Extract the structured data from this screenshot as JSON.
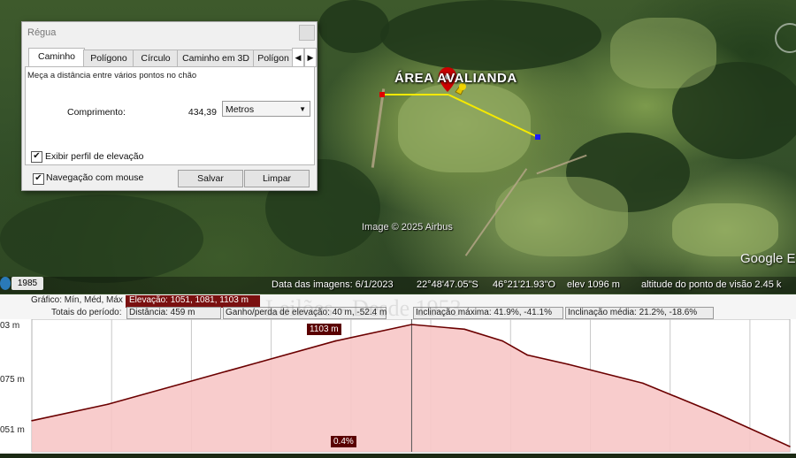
{
  "map": {
    "area_label": "ÁREA AVALIANDA",
    "image_credit": "Image © 2025 Airbus",
    "google_logo": "Google E",
    "status": {
      "year": "1985",
      "imagery_date": "Data das imagens: 6/1/2023",
      "latitude": "22°48'47.05\"S",
      "longitude": "46°21'21.93\"O",
      "elevation": "elev 1096 m",
      "eye_altitude": "altitude do ponto de visão 2.45 k"
    },
    "path_color": "#f5e900",
    "start_marker_color": "#e00000",
    "end_marker_color": "#1a1aff",
    "pin_color": "#e4c400"
  },
  "dialog": {
    "title": "Régua",
    "tabs": [
      "Caminho",
      "Polígono",
      "Círculo",
      "Caminho em 3D",
      "Polígon"
    ],
    "active_tab": "Caminho",
    "tab_prev": "◀",
    "tab_next": "▶",
    "description": "Meça a distância entre vários pontos no chão",
    "length_label": "Comprimento:",
    "length_value": "434,39",
    "unit": "Metros",
    "show_elevation_label": "Exibir perfil de elevação",
    "show_elevation_checked": true,
    "mouse_nav_label": "Navegação com mouse",
    "mouse_nav_checked": true,
    "save_label": "Salvar",
    "clear_label": "Limpar",
    "check_mark": "✔"
  },
  "elevation_panel": {
    "row1": {
      "prefix": "Gráfico: Mín, Méd, Máx",
      "elevation": "Elevação: 1051, 1081, 1103 m"
    },
    "row2": {
      "totals_label": "Totais do período:",
      "distance": "Distância: 459 m",
      "gain_loss": "Ganho/perda de elevação: 40 m, -52.4 m",
      "max_slope": "Inclinação máxima: 41.9%, -41.1%",
      "avg_slope": "Inclinação média: 21.2%, -18.6%"
    },
    "cursor_label": "1103 m",
    "slope_label": "0.4%",
    "watermark": "Leilões - Desde 1953",
    "fill_color": "#f7c6c6",
    "line_color": "#6b0000"
  },
  "chart_data": {
    "type": "area",
    "title": "",
    "xlabel": "",
    "ylabel": "",
    "ytick_labels": [
      "03 m",
      "075 m",
      "051 m"
    ],
    "ylim": [
      1051,
      1103
    ],
    "xlim": [
      0,
      459
    ],
    "x": [
      0,
      46,
      92,
      138,
      184,
      230,
      262,
      285,
      300,
      325,
      370,
      415,
      459
    ],
    "values": [
      1062,
      1069,
      1078,
      1087,
      1096,
      1103,
      1101,
      1096,
      1090,
      1086,
      1078,
      1065,
      1051
    ]
  }
}
